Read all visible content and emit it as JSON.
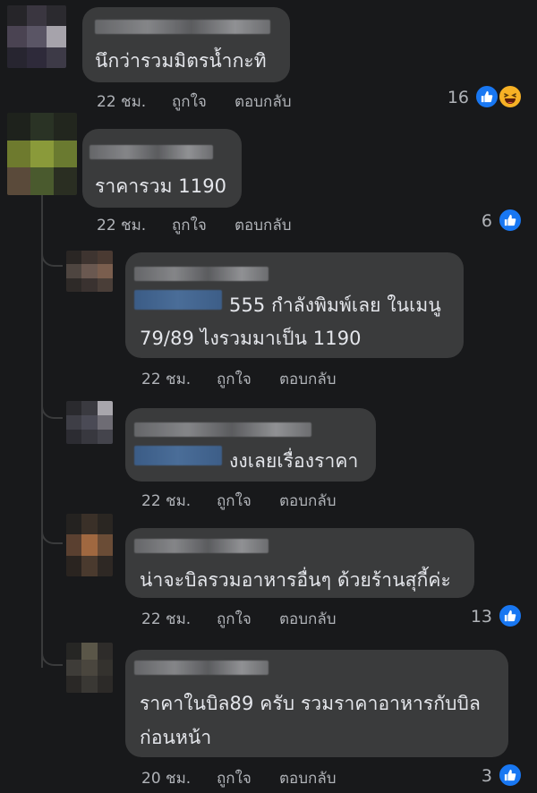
{
  "comments": [
    {
      "text_lines": [
        "นึกว่ารวมมิตรน้ำกะทิ"
      ],
      "time": "22 ชม.",
      "like_label": "ถูกใจ",
      "reply_label": "ตอบกลับ",
      "reaction_count": "16",
      "reactions": [
        "like-icon",
        "haha-icon"
      ]
    },
    {
      "text_lines": [
        "ราคารวม 1190"
      ],
      "time": "22 ชม.",
      "like_label": "ถูกใจ",
      "reply_label": "ตอบกลับ",
      "reaction_count": "6",
      "reactions": [
        "like-icon"
      ]
    }
  ],
  "replies": [
    {
      "text_lines": [
        "555 กำลังพิมพ์เลย ในเมนู",
        "79/89 ไงรวมมาเป็น 1190"
      ],
      "time": "22 ชม.",
      "like_label": "ถูกใจ",
      "reply_label": "ตอบกลับ",
      "reaction_count": ""
    },
    {
      "text_lines": [
        "งงเลยเรื่องราคา"
      ],
      "time": "22 ชม.",
      "like_label": "ถูกใจ",
      "reply_label": "ตอบกลับ",
      "reaction_count": ""
    },
    {
      "text_lines": [
        "น่าจะบิลรวมอาหารอื่นๆ ด้วยร้านสุกี้ค่ะ"
      ],
      "time": "22 ชม.",
      "like_label": "ถูกใจ",
      "reply_label": "ตอบกลับ",
      "reaction_count": "13",
      "reactions": [
        "like-icon"
      ]
    },
    {
      "text_lines": [
        "ราคาในบิล89 ครับ รวมราคาอาหารกับบิล",
        "ก่อนหน้า"
      ],
      "time": "20 ชม.",
      "like_label": "ถูกใจ",
      "reply_label": "ตอบกลับ",
      "reaction_count": "3",
      "reactions": [
        "like-icon"
      ]
    }
  ],
  "colors": {
    "background": "#18191b",
    "bubble": "#3a3b3c",
    "text": "#e4e6eb",
    "meta": "#b0b3b8",
    "like_blue": "#1877f2",
    "haha_yellow": "#f7b125"
  }
}
